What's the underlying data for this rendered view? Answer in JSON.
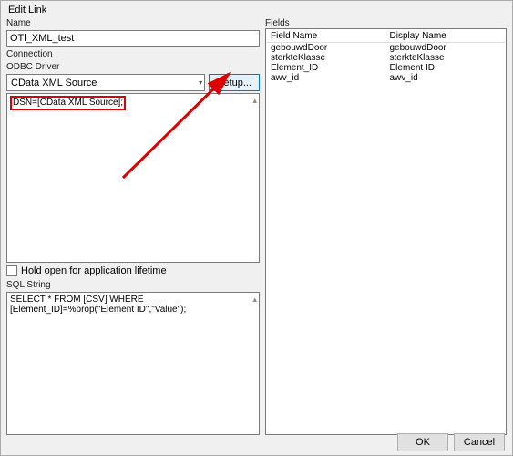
{
  "dialog_title": "Edit Link",
  "left": {
    "name_label": "Name",
    "name_value": "OTl_XML_test",
    "connection_label": "Connection",
    "odbc_label": "ODBC Driver",
    "odbc_value": "CData XML Source",
    "setup_button": "Setup...",
    "conn_string": "DSN=[CData XML Source];",
    "hold_open_label": "Hold open for application lifetime",
    "sql_label": "SQL String",
    "sql_value": "SELECT * FROM [CSV] WHERE [Element_ID]=%prop(\"Element ID\",\"Value\");"
  },
  "right": {
    "fields_label": "Fields",
    "col_field": "Field Name",
    "col_display": "Display Name",
    "rows": [
      {
        "field": "gebouwdDoor",
        "display": "gebouwdDoor"
      },
      {
        "field": "sterkteKlasse",
        "display": "sterkteKlasse"
      },
      {
        "field": "Element_ID",
        "display": "Element ID"
      },
      {
        "field": "awv_id",
        "display": "awv_id"
      }
    ]
  },
  "footer": {
    "ok": "OK",
    "cancel": "Cancel"
  },
  "colors": {
    "highlight": "#d00",
    "btn_accent_border": "#0078d7",
    "btn_accent_bg": "#e5f1fb"
  }
}
